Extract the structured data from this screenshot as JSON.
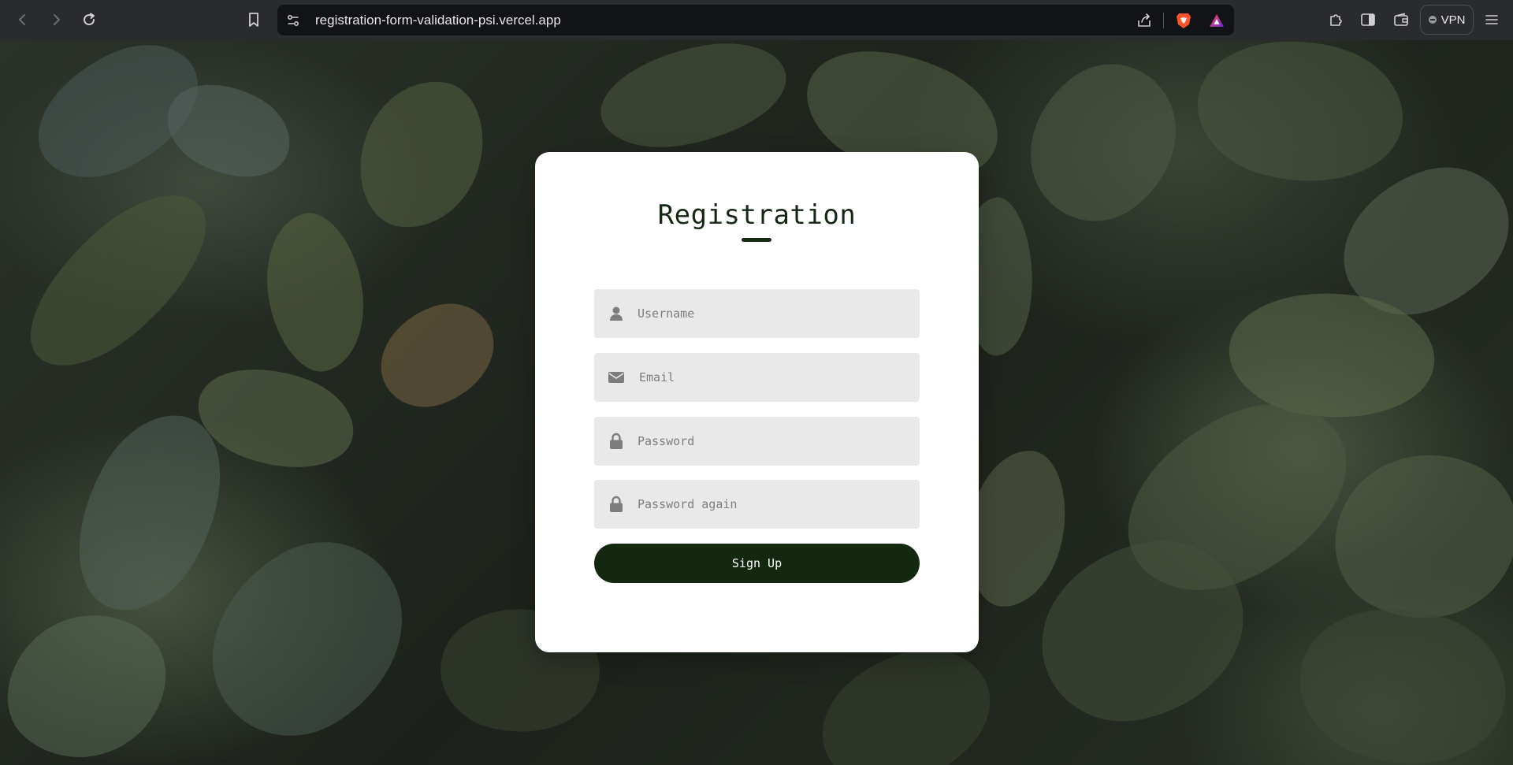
{
  "browser": {
    "url": "registration-form-validation-psi.vercel.app",
    "vpn_label": "VPN"
  },
  "form": {
    "title": "Registration",
    "fields": [
      {
        "name": "username",
        "placeholder": "Username",
        "icon": "user-icon"
      },
      {
        "name": "email",
        "placeholder": "Email",
        "icon": "envelope-icon"
      },
      {
        "name": "password",
        "placeholder": "Password",
        "icon": "lock-icon"
      },
      {
        "name": "password_again",
        "placeholder": "Password again",
        "icon": "lock-icon"
      }
    ],
    "submit_label": "Sign Up"
  },
  "colors": {
    "accent": "#142810",
    "field_bg": "#e9e9e9",
    "card_bg": "#ffffff",
    "icon": "#7d7d7d"
  }
}
